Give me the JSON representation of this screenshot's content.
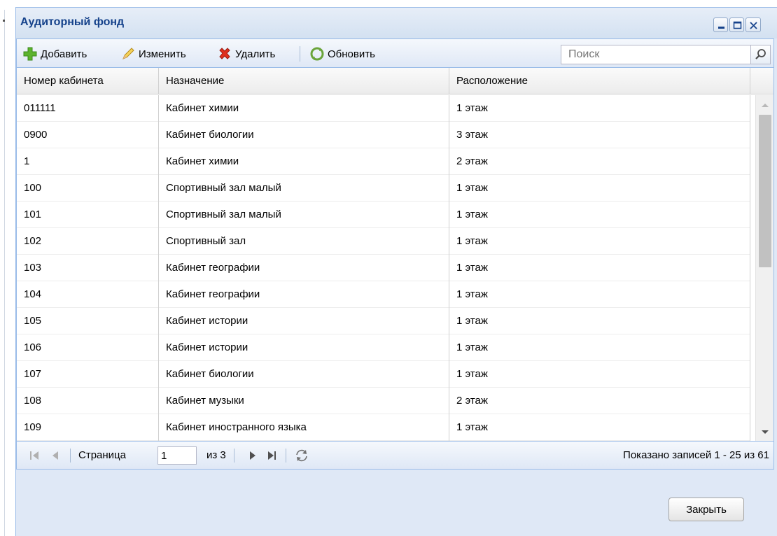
{
  "window": {
    "title": "Аудиторный фонд"
  },
  "toolbar": {
    "add_label": "Добавить",
    "edit_label": "Изменить",
    "delete_label": "Удалить",
    "refresh_label": "Обновить",
    "search_placeholder": "Поиск"
  },
  "grid": {
    "columns": [
      "Номер кабинета",
      "Назначение",
      "Расположение"
    ],
    "rows": [
      [
        "011111",
        "Кабинет химии",
        "1 этаж"
      ],
      [
        "0900",
        "Кабинет биологии",
        "3 этаж"
      ],
      [
        "1",
        "Кабинет химии",
        "2 этаж"
      ],
      [
        "100",
        "Спортивный зал малый",
        "1 этаж"
      ],
      [
        "101",
        "Спортивный зал малый",
        "1 этаж"
      ],
      [
        "102",
        "Спортивный зал",
        "1 этаж"
      ],
      [
        "103",
        "Кабинет географии",
        "1 этаж"
      ],
      [
        "104",
        "Кабинет географии",
        "1 этаж"
      ],
      [
        "105",
        "Кабинет истории",
        "1 этаж"
      ],
      [
        "106",
        "Кабинет истории",
        "1 этаж"
      ],
      [
        "107",
        "Кабинет биологии",
        "1 этаж"
      ],
      [
        "108",
        "Кабинет музыки",
        "2 этаж"
      ],
      [
        "109",
        "Кабинет иностранного языка",
        "1 этаж"
      ]
    ]
  },
  "paging": {
    "page_label": "Страница",
    "page_value": "1",
    "of_label": "из 3",
    "info": "Показано записей 1 - 25 из 61"
  },
  "footer": {
    "close_label": "Закрыть"
  },
  "icons": {
    "add": "plus-icon",
    "edit": "pencil-icon",
    "delete": "red-x-icon",
    "refresh": "refresh-icon",
    "search": "magnifier-icon"
  },
  "colors": {
    "window_border": "#99bbe8",
    "title_text": "#15428b",
    "toolbar_bg": "#dfe8f6"
  }
}
